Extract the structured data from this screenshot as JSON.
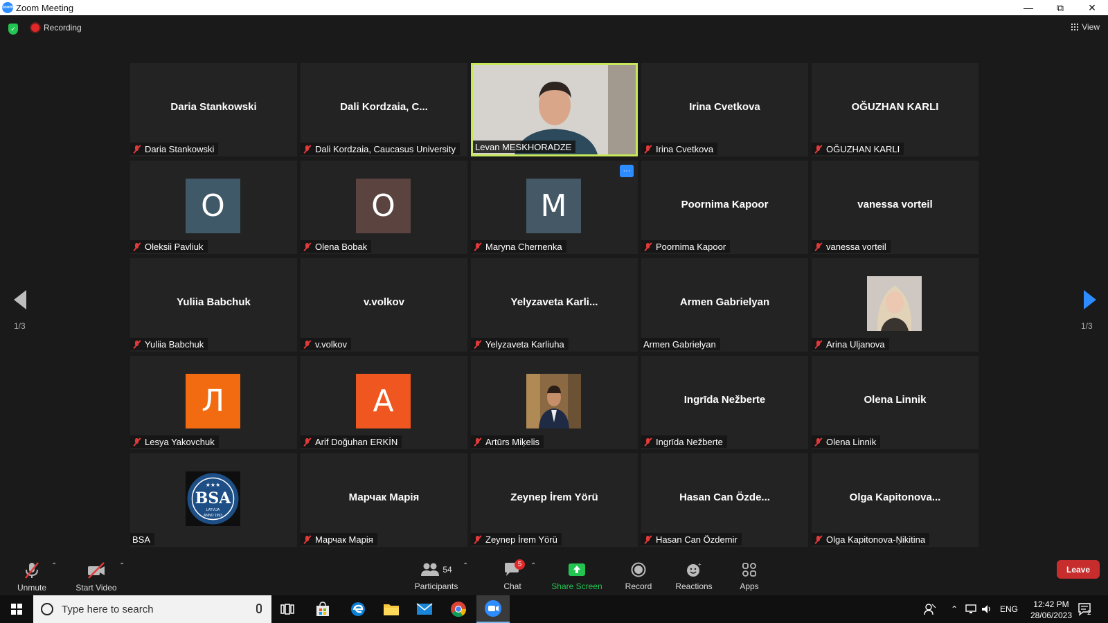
{
  "window": {
    "title": "Zoom Meeting",
    "app_icon": "zoom-icon"
  },
  "topbar": {
    "recording_label": "Recording",
    "view_label": "View"
  },
  "colors": {
    "accent": "#2d8cff",
    "active_border": "#c6e85a",
    "leave": "#c72d2d",
    "muted": "#e03a3a",
    "share": "#23c552"
  },
  "grid": {
    "tiles": [
      {
        "big": "Daria Stankowski",
        "label": "Daria Stankowski",
        "muted": true
      },
      {
        "big": "Dali  Kordzaia, C...",
        "label": "Dali Kordzaia, Caucasus University",
        "muted": true
      },
      {
        "video": true,
        "label": "Levan MESKHORADZE",
        "muted": false,
        "active": true
      },
      {
        "big": "Irina Cvetkova",
        "label": "Irina Cvetkova",
        "muted": true
      },
      {
        "big": "OĞUZHAN KARLI",
        "label": "OĞUZHAN KARLI",
        "muted": true
      },
      {
        "avatar": "O",
        "avatar_color": "#405968",
        "label": "Oleksii Pavliuk",
        "muted": true
      },
      {
        "avatar": "O",
        "avatar_color": "#5b4440",
        "label": "Olena Bobak",
        "muted": true
      },
      {
        "avatar": "M",
        "avatar_color": "#445866",
        "label": "Maryna Chernenka",
        "muted": true,
        "more": "···"
      },
      {
        "big": "Poornima Kapoor",
        "label": "Poornima Kapoor",
        "muted": true
      },
      {
        "big": "vanessa vorteil",
        "label": "vanessa vorteil",
        "muted": true
      },
      {
        "big": "Yuliia Babchuk",
        "label": "Yuliia Babchuk",
        "muted": true
      },
      {
        "big": "v.volkov",
        "label": "v.volkov",
        "muted": true
      },
      {
        "big": "Yelyzaveta  Karli...",
        "label": "Yelyzaveta Karliuha",
        "muted": true
      },
      {
        "big": "Armen Gabrielyan",
        "label": "Armen Gabrielyan",
        "muted": false
      },
      {
        "photo": "woman",
        "label": "Arina Uljanova",
        "muted": true
      },
      {
        "avatar": "Л",
        "avatar_color": "#f26b10",
        "label": "Lesya Yakovchuk",
        "muted": true
      },
      {
        "avatar": "A",
        "avatar_color": "#f0561f",
        "label": "Arif Doğuhan ERKİN",
        "muted": true
      },
      {
        "photo": "man",
        "label": "Artūrs Miķelis",
        "muted": true
      },
      {
        "big": "Ingrīda Nežberte",
        "label": "Ingrīda Nežberte",
        "muted": true
      },
      {
        "big": "Olena Linnik",
        "label": "Olena Linnik",
        "muted": true
      },
      {
        "photo": "bsa-logo",
        "label": "BSA",
        "muted": false
      },
      {
        "big": "Марчак Марія",
        "label": "Марчак Марія",
        "muted": true
      },
      {
        "big": "Zeynep İrem Yörü",
        "label": "Zeynep İrem Yörü",
        "muted": true
      },
      {
        "big": "Hasan Can Özde...",
        "label": "Hasan Can Özdemir",
        "muted": true
      },
      {
        "big": "Olga  Kapitonova...",
        "label": "Olga Kapitonova-Ņikitina",
        "muted": true
      }
    ]
  },
  "pager": {
    "left": "1/3",
    "right": "1/3"
  },
  "controls": {
    "unmute": "Unmute",
    "start_video": "Start Video",
    "participants": "Participants",
    "participants_count": "54",
    "chat": "Chat",
    "chat_badge": "5",
    "share_screen": "Share Screen",
    "record": "Record",
    "reactions": "Reactions",
    "apps": "Apps",
    "leave": "Leave"
  },
  "taskbar": {
    "search_placeholder": "Type here to search",
    "language": "ENG",
    "time": "12:42 PM",
    "date": "28/06/2023",
    "notifications": "2"
  }
}
